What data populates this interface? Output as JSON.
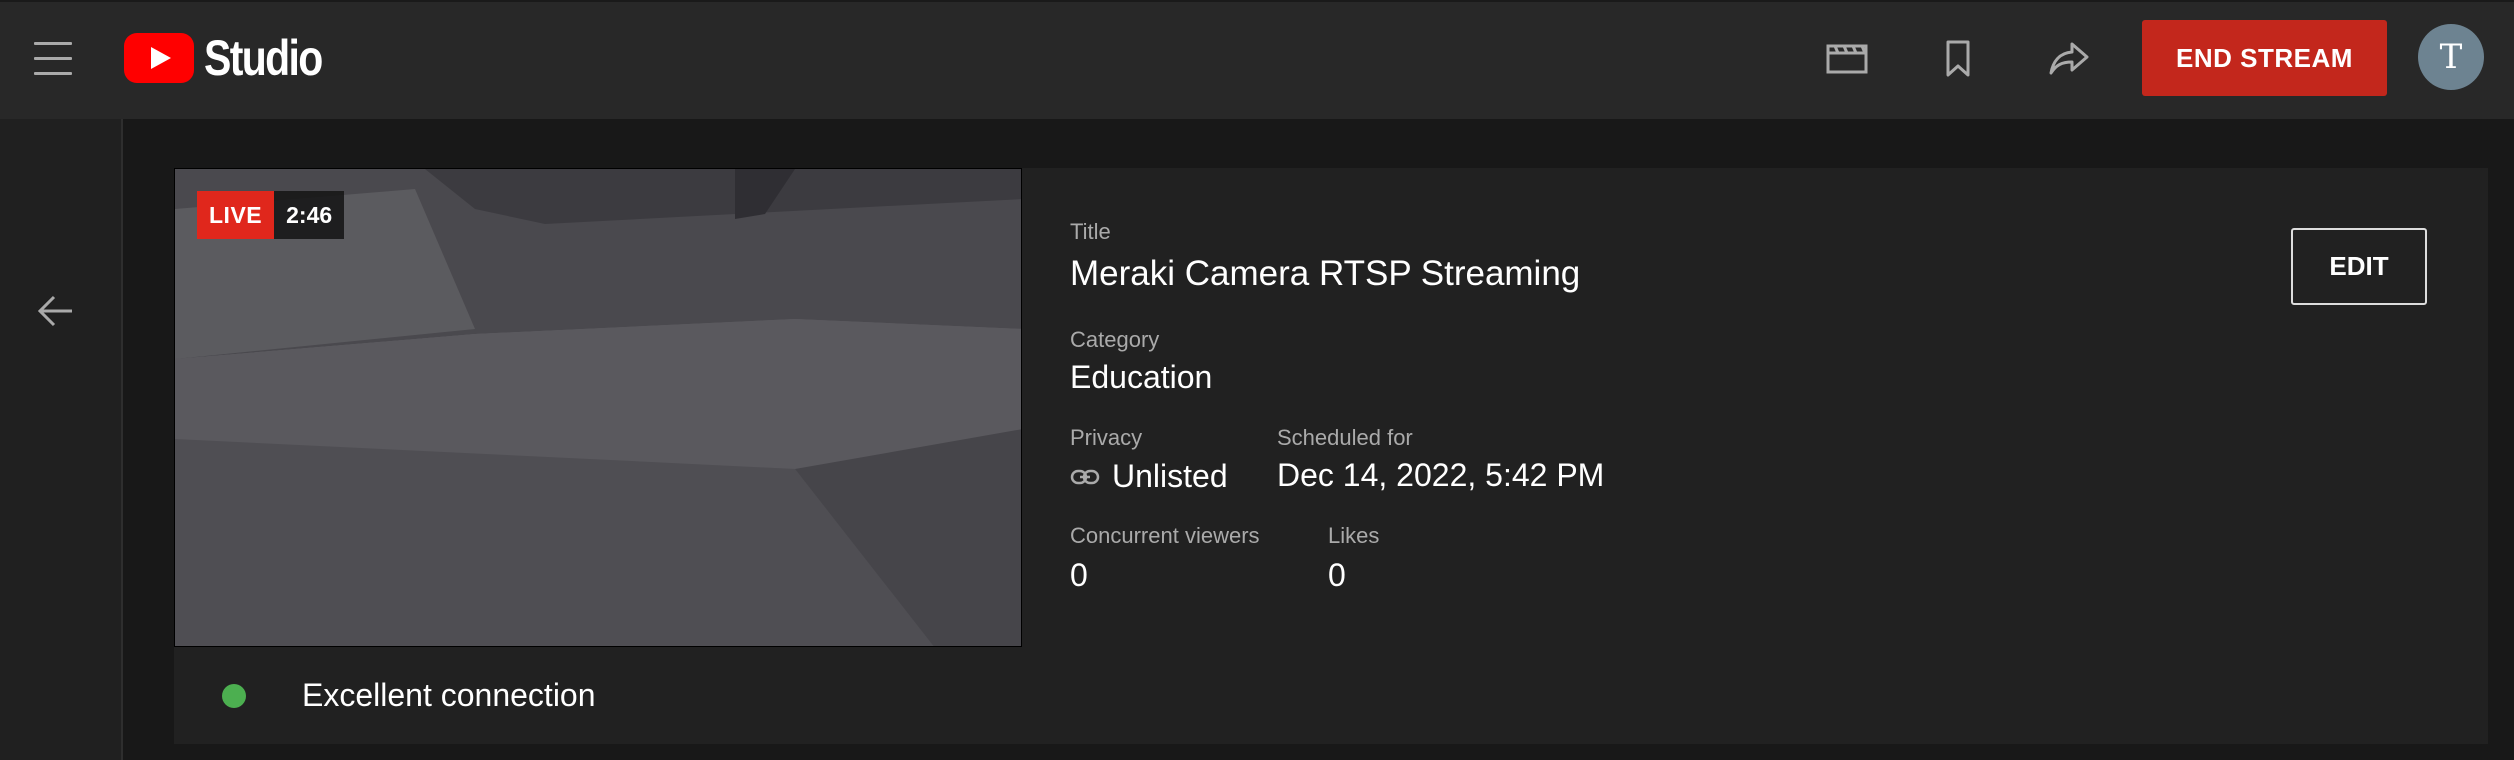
{
  "app": {
    "logo_text": "Studio",
    "brand_color": "#ff0000"
  },
  "header": {
    "icons": [
      "clapperboard-icon",
      "bookmark-icon",
      "share-icon"
    ],
    "end_stream_label": "END STREAM",
    "end_stream_color": "#c3271c",
    "avatar_initial": "T"
  },
  "stream": {
    "live_label": "LIVE",
    "elapsed": "2:46",
    "title_label": "Title",
    "title": "Meraki Camera RTSP Streaming",
    "category_label": "Category",
    "category": "Education",
    "privacy_label": "Privacy",
    "privacy": "Unlisted",
    "scheduled_label": "Scheduled for",
    "scheduled": "Dec 14, 2022, 5:42 PM",
    "viewers_label": "Concurrent viewers",
    "viewers": "0",
    "likes_label": "Likes",
    "likes": "0",
    "edit_label": "EDIT"
  },
  "connection": {
    "status": "Excellent connection",
    "status_color": "#4caf50"
  }
}
